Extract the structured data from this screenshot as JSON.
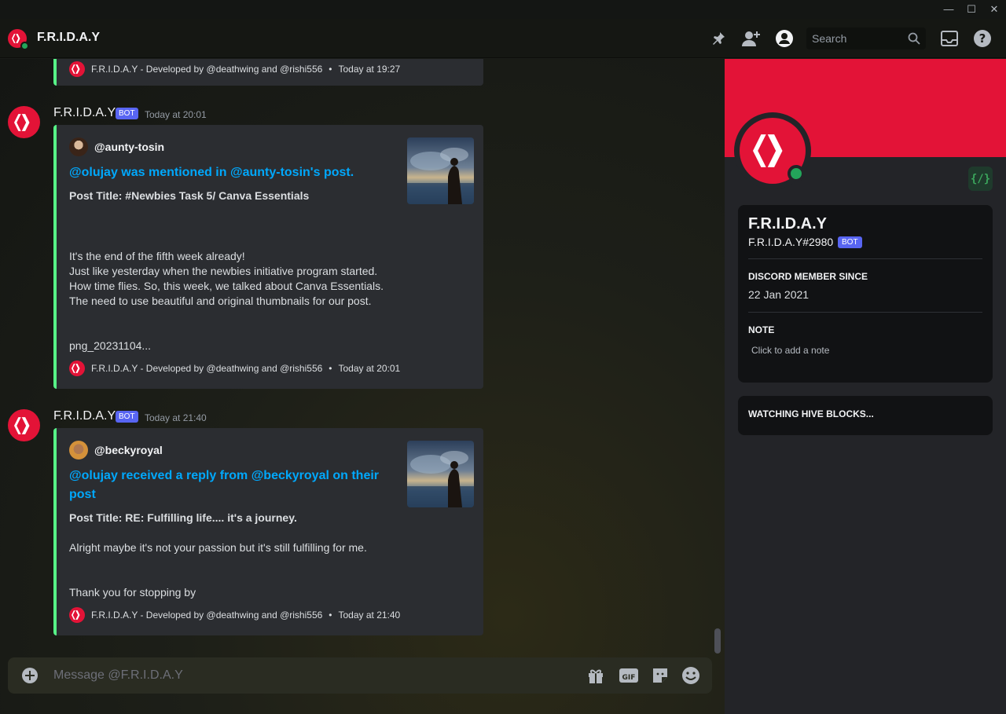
{
  "window": {
    "minimize_glyph": "—",
    "maximize_glyph": "☐",
    "close_glyph": "✕"
  },
  "header": {
    "title": "F.R.I.D.A.Y",
    "search_placeholder": "Search",
    "icons": [
      "pin-icon",
      "add-friend-icon",
      "profile-toggle-icon",
      "search-icon",
      "inbox-icon",
      "help-icon"
    ]
  },
  "messages": {
    "top_footer": {
      "text": "F.R.I.D.A.Y - Developed by @deathwing and @rishi556",
      "time": "Today at 19:27"
    },
    "msg1": {
      "author": "F.R.I.D.A.Y",
      "badge": "BOT",
      "time": "Today at 20:01",
      "embed": {
        "author": "@aunty-tosin",
        "title": "@olujay was mentioned in @aunty-tosin's post.",
        "post_title": "Post Title: #Newbies Task 5/ Canva Essentials",
        "desc_lines": [
          "It's the end of the fifth week already!",
          "Just like yesterday when the newbies initiative program started.",
          "How time flies. So, this week, we talked about Canva Essentials.",
          "The need to use beautiful and original thumbnails for our post."
        ],
        "desc_tail": "png_20231104...",
        "footer": "F.R.I.D.A.Y - Developed by @deathwing and @rishi556",
        "footer_time": "Today at 20:01"
      }
    },
    "msg2": {
      "author": "F.R.I.D.A.Y",
      "badge": "BOT",
      "time": "Today at 21:40",
      "embed": {
        "author": "@beckyroyal",
        "title": "@olujay received a reply from @beckyroyal on their post",
        "post_title": "Post Title: RE: Fulfilling life.... it's a journey.",
        "desc": "Alright maybe it's not your passion but it's still fulfilling for me.",
        "desc_tail": "Thank you for stopping by",
        "footer": "F.R.I.D.A.Y - Developed by @deathwing and @rishi556",
        "footer_time": "Today at 21:40"
      }
    },
    "separator": "•"
  },
  "composer": {
    "placeholder": "Message @F.R.I.D.A.Y",
    "gif_label": "GIF"
  },
  "profile": {
    "name": "F.R.I.D.A.Y",
    "tag": "F.R.I.D.A.Y#2980",
    "badge": "BOT",
    "dev_badge": "{/}",
    "member_since_label": "DISCORD MEMBER SINCE",
    "member_since": "22 Jan 2021",
    "note_label": "NOTE",
    "note_placeholder": "Click to add a note",
    "activity": "WATCHING HIVE BLOCKS..."
  },
  "colors": {
    "hive_red": "#e31337",
    "embed_accent": "#57f287",
    "link_blue": "#00a8fc",
    "bot_badge": "#5865f2",
    "online": "#23a55a"
  }
}
